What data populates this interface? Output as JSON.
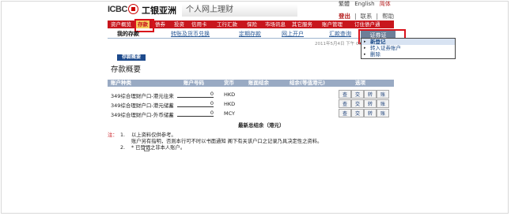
{
  "header": {
    "brand_mark": "ICBC",
    "brand_cn": "工银亚洲",
    "section_title": "个人网上理财",
    "top_links": [
      "繁體",
      "English",
      "简体"
    ],
    "actions": {
      "logout": "登出",
      "contact": "联系",
      "help": "帮助"
    }
  },
  "nav": {
    "items": [
      "资户概览",
      "存款",
      "债券",
      "投资",
      "信用卡",
      "工行汇款",
      "保险",
      "市场讯息",
      "其它服务",
      "账户管理",
      "订住债户通"
    ],
    "active_index": 1
  },
  "subnav": {
    "items": [
      "我的存款",
      "转账及货币兑换",
      "定期存款",
      "网上开户",
      "汇款查询"
    ],
    "current_index": 0,
    "extra_tab": "证券证"
  },
  "dropdown": {
    "items": [
      "新登记",
      "转入证券账户",
      "删除"
    ],
    "highlight_index": 0,
    "timestamp": "2011年5月4日 下午 06"
  },
  "main": {
    "tab_label": "存款概要",
    "title": "存款概要",
    "table_headers": [
      "账户种类",
      "账户号码",
      "货币",
      "账面结余",
      "结余(等值港元)",
      "选项"
    ],
    "rows": [
      {
        "type": "349综合理财户口-港元往来",
        "amount": "0",
        "currency": "HKD",
        "buttons": [
          "查",
          "交",
          "转",
          "账"
        ]
      },
      {
        "type": "349综合理财户口-港元储蓄",
        "amount": "0",
        "currency": "HKD",
        "buttons": [
          "查",
          "交",
          "转",
          "账"
        ]
      },
      {
        "type": "349综合理财户口-外币储蓄",
        "amount": "0",
        "currency": "MCY",
        "buttons": [
          "查",
          "交",
          "转",
          "账"
        ]
      }
    ],
    "total_label": "最新总结余（港元）"
  },
  "notes": {
    "marker": "注：",
    "items": [
      {
        "num": "1.",
        "line1": "以上资料仅供参考。",
        "line2": "账户另有指明，否则本行可不时以书面通知   阁下有关该户口之记录乃具决定性之资料。"
      },
      {
        "num": "2.",
        "line1": "* 已登记之非本人账户。"
      }
    ]
  }
}
